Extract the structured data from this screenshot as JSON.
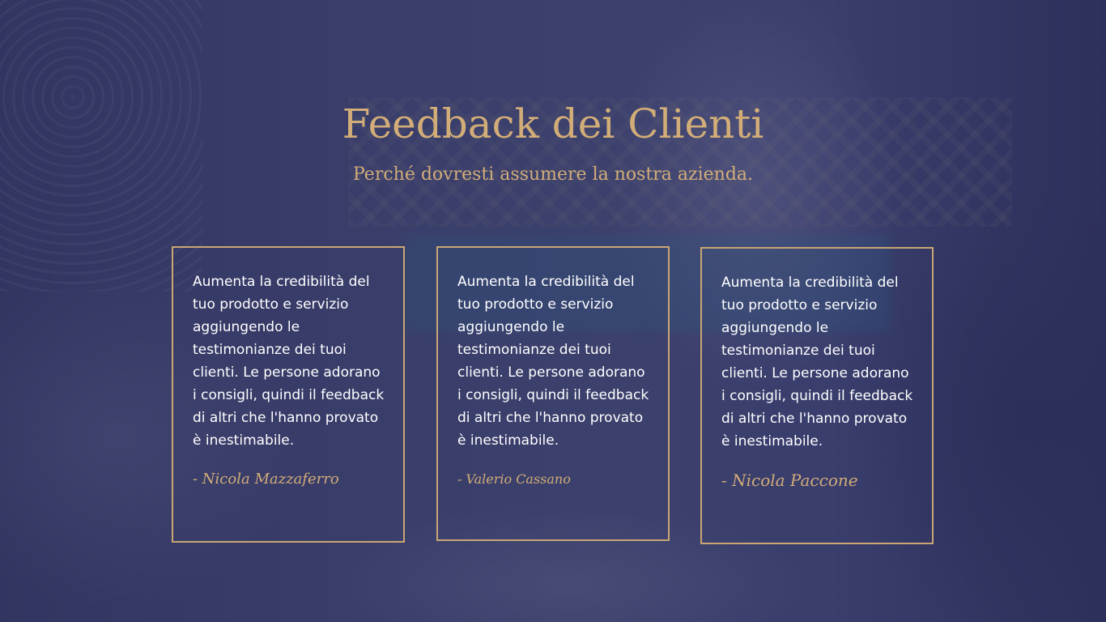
{
  "header": {
    "title": "Feedback dei Clienti",
    "subtitle": "Perché dovresti assumere la nostra azienda."
  },
  "testimonials": [
    {
      "text": "Aumenta la credibilità del tuo prodotto e servizio aggiungendo le testimonianze dei tuoi clienti. Le persone adorano i consigli, quindi il feedback di altri che l'hanno provato è inestimabile.",
      "author": "- Nicola Mazzaferro"
    },
    {
      "text": "Aumenta la credibilità del tuo prodotto e servizio aggiungendo le testimonianze dei tuoi clienti. Le persone adorano i consigli, quindi il feedback di altri che l'hanno provato è inestimabile.",
      "author": "- Valerio Cassano"
    },
    {
      "text": "Aumenta la credibilità del tuo prodotto e servizio aggiungendo le testimonianze dei tuoi clienti. Le persone adorano i consigli, quindi il feedback di altri che l'hanno provato è inestimabile.",
      "author": "- Nicola Paccone"
    }
  ],
  "colors": {
    "accent_gold": "#d2ad78",
    "card_border": "#c9a673",
    "overlay_navy": "#2c305c",
    "body_text": "#ffffff"
  }
}
